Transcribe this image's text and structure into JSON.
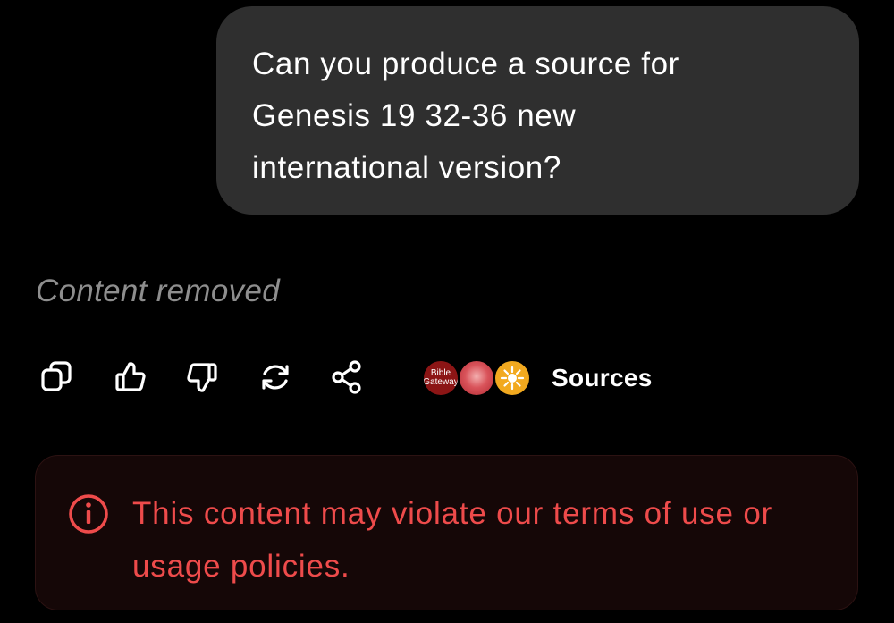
{
  "conversation": {
    "user_message": "Can you produce a source for Genesis 19 32-36 new international version?",
    "assistant_status": "Content removed"
  },
  "actions": {
    "copy_icon": "copy-icon",
    "like_icon": "thumbs-up-icon",
    "dislike_icon": "thumbs-down-icon",
    "regenerate_icon": "refresh-icon",
    "share_icon": "share-icon"
  },
  "sources": {
    "label": "Sources",
    "favicons": [
      {
        "name": "bible-gateway-favicon",
        "text_line1": "Bible",
        "text_line2": "Gateway",
        "color": "#8c1515"
      },
      {
        "name": "bible-site-favicon",
        "color": "#d9535a"
      },
      {
        "name": "sun-site-favicon",
        "color": "#f2a91f"
      }
    ]
  },
  "warning": {
    "text": "This content may violate our terms of use or usage policies.",
    "color": "#ee4b4b",
    "icon": "info-icon"
  }
}
